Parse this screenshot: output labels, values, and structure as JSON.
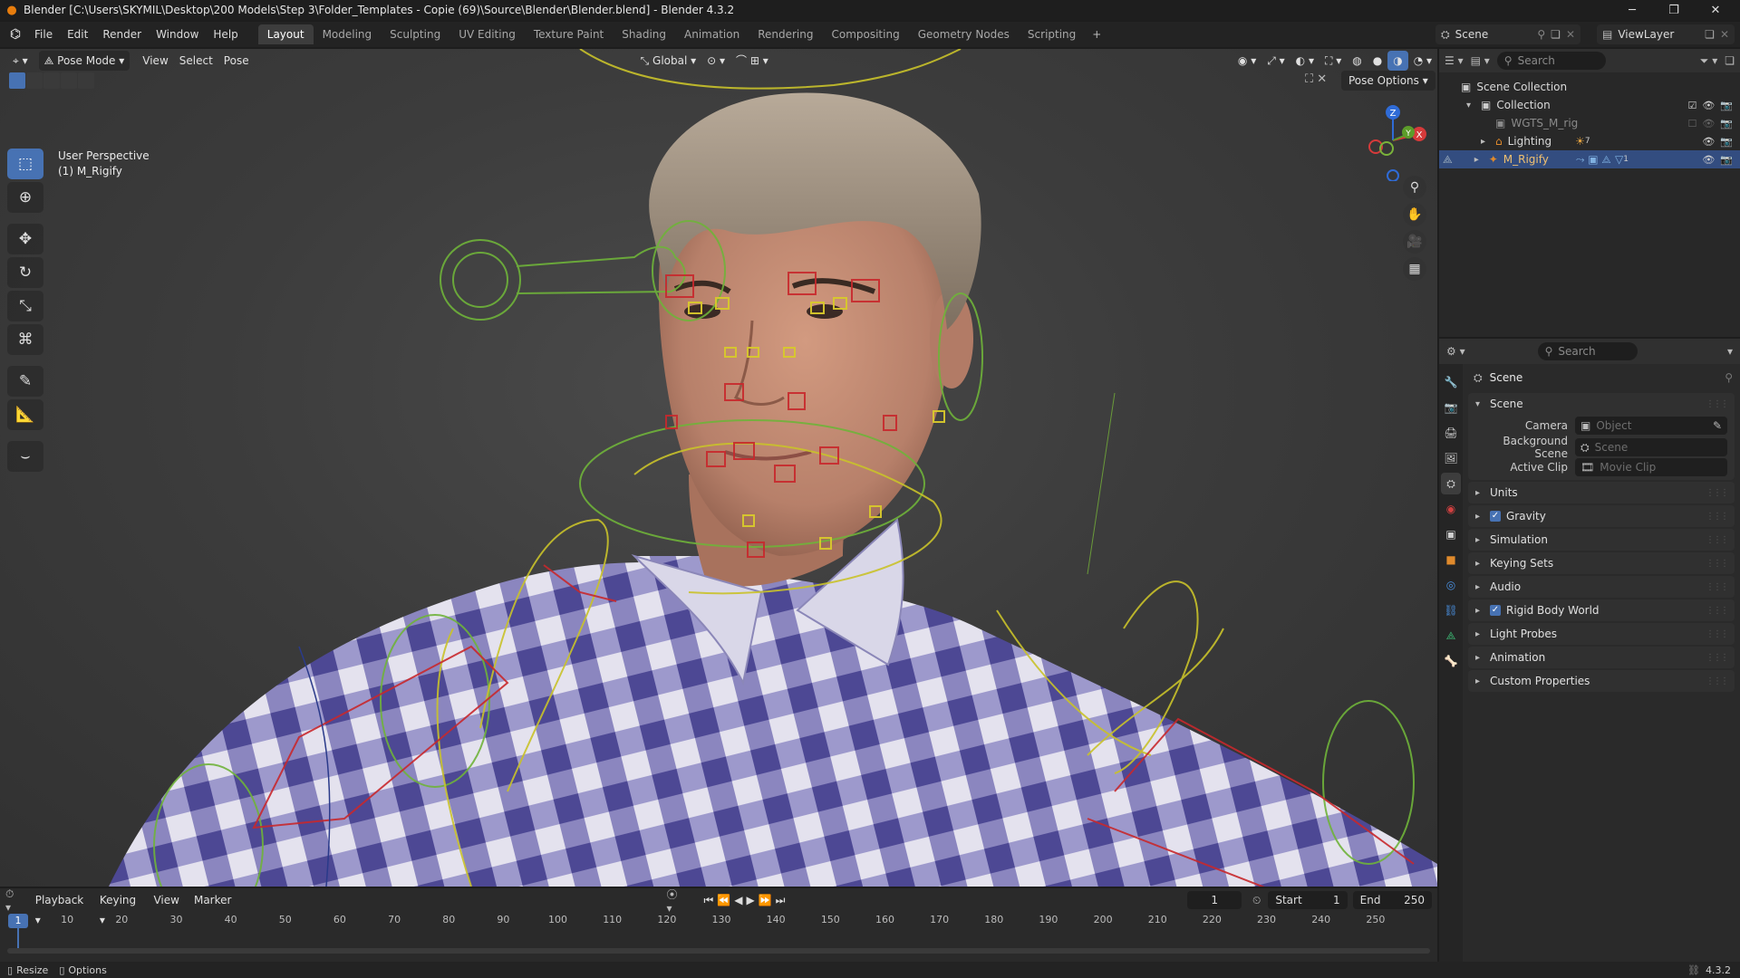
{
  "window": {
    "title": "Blender [C:\\Users\\SKYMIL\\Desktop\\200 Models\\Step 3\\Folder_Templates - Copie (69)\\Source\\Blender\\Blender.blend] - Blender 4.3.2"
  },
  "menubar": {
    "menus": [
      "File",
      "Edit",
      "Render",
      "Window",
      "Help"
    ],
    "workspaces": [
      "Layout",
      "Modeling",
      "Sculpting",
      "UV Editing",
      "Texture Paint",
      "Shading",
      "Animation",
      "Rendering",
      "Compositing",
      "Geometry Nodes",
      "Scripting"
    ],
    "active_workspace": "Layout",
    "add_tab": "+",
    "scene_name": "Scene",
    "view_layer": "ViewLayer"
  },
  "viewport": {
    "mode": "Pose Mode",
    "menus": [
      "View",
      "Select",
      "Pose"
    ],
    "transform_orientation": "Global",
    "pose_options": "Pose Options",
    "info_line1": "User Perspective",
    "info_line2": "(1) M_Rigify",
    "gizmo_axis_z": "Z",
    "gizmo_axis_x": "X",
    "gizmo_axis_y": "Y"
  },
  "outliner": {
    "search_placeholder": "Search",
    "rows": [
      {
        "label": "Scene Collection"
      },
      {
        "label": "Collection"
      },
      {
        "label": "WGTS_M_rig"
      },
      {
        "label": "Lighting",
        "badge": "7"
      },
      {
        "label": "M_Rigify",
        "badge": "1"
      }
    ]
  },
  "properties": {
    "search_placeholder": "Search",
    "context_title": "Scene",
    "panel_scene": "Scene",
    "camera_label": "Camera",
    "camera_placeholder": "Object",
    "background_scene_label": "Background Scene",
    "background_scene_placeholder": "Scene",
    "active_clip_label": "Active Clip",
    "active_clip_placeholder": "Movie Clip",
    "panels": [
      {
        "label": "Units",
        "checkbox": false
      },
      {
        "label": "Gravity",
        "checkbox": true
      },
      {
        "label": "Simulation",
        "checkbox": false
      },
      {
        "label": "Keying Sets",
        "checkbox": false
      },
      {
        "label": "Audio",
        "checkbox": false
      },
      {
        "label": "Rigid Body World",
        "checkbox": true
      },
      {
        "label": "Light Probes",
        "checkbox": false
      },
      {
        "label": "Animation",
        "checkbox": false
      },
      {
        "label": "Custom Properties",
        "checkbox": false
      }
    ]
  },
  "timeline": {
    "menus": [
      "Playback",
      "Keying",
      "View",
      "Marker"
    ],
    "current_frame": "1",
    "start_label": "Start",
    "start_value": "1",
    "end_label": "End",
    "end_value": "250",
    "ruler_ticks": [
      "10",
      "20",
      "30",
      "40",
      "50",
      "60",
      "70",
      "80",
      "90",
      "100",
      "110",
      "120",
      "130",
      "140",
      "150",
      "160",
      "170",
      "180",
      "190",
      "200",
      "210",
      "220",
      "230",
      "240",
      "250"
    ],
    "playhead_label": "1"
  },
  "statusbar": {
    "left1": "Resize",
    "left2": "Options",
    "version": "4.3.2"
  },
  "colors": {
    "accent": "#4772b3",
    "bone_yellow": "#c9c22a",
    "bone_green": "#6fb33a",
    "bone_red": "#c8282c",
    "blender_orange": "#e87d0d"
  }
}
